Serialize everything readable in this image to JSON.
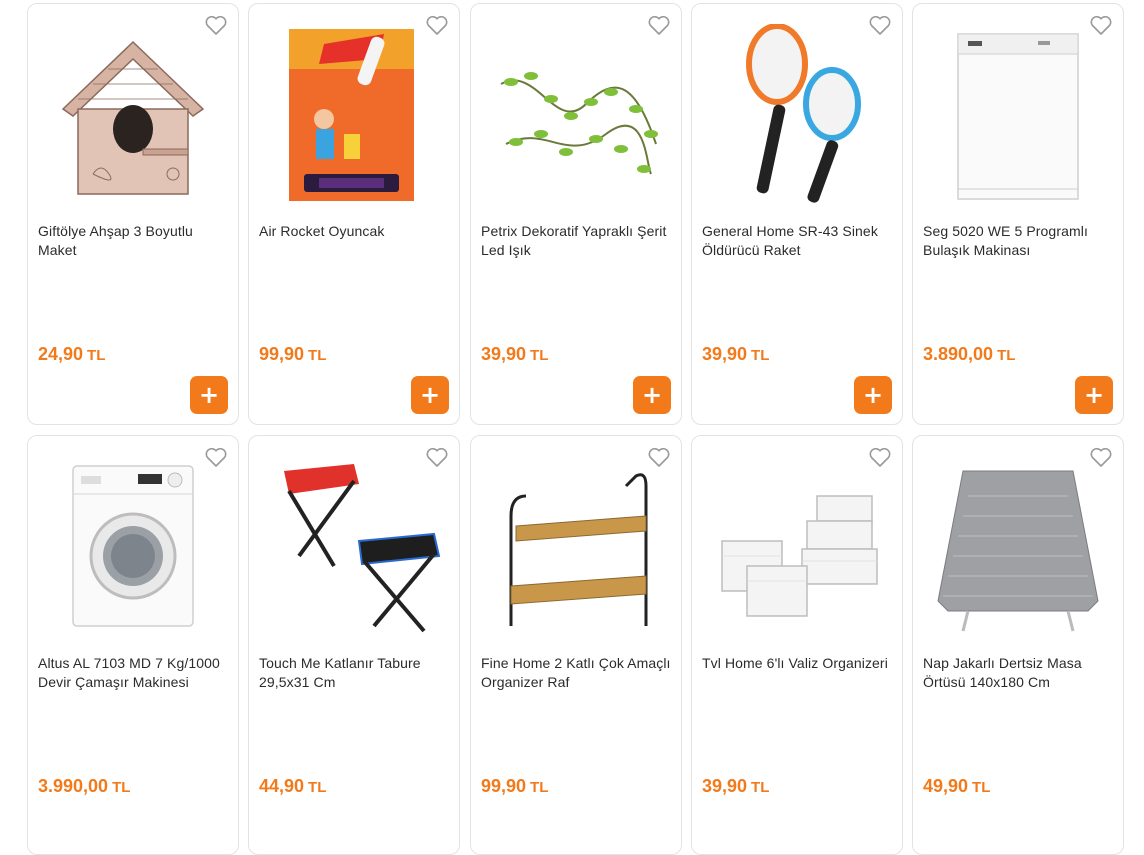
{
  "colors": {
    "accent": "#f27a1a",
    "border": "#e3e3e3",
    "text": "#2b2b2b"
  },
  "icons": {
    "favorite": "heart-outline-icon",
    "add": "plus-icon"
  },
  "add_label": "+",
  "products": [
    {
      "title": "Giftölye Ahşap 3 Boyutlu Maket",
      "price": "24,90",
      "currency": "TL",
      "image": "wooden-birdhouse"
    },
    {
      "title": "Air Rocket Oyuncak",
      "price": "99,90",
      "currency": "TL",
      "image": "air-rocket-box"
    },
    {
      "title": "Petrix Dekoratif Yapraklı Şerit Led Işık",
      "price": "39,90",
      "currency": "TL",
      "image": "leaf-garland"
    },
    {
      "title": "General Home SR-43 Sinek Öldürücü Raket",
      "price": "39,90",
      "currency": "TL",
      "image": "fly-swatter-rackets"
    },
    {
      "title": "Seg 5020 WE 5 Programlı Bulaşık Makinası",
      "price": "3.890,00",
      "currency": "TL",
      "image": "dishwasher"
    },
    {
      "title": "Altus AL 7103 MD 7 Kg/1000 Devir Çamaşır Makinesi",
      "price": "3.990,00",
      "currency": "TL",
      "image": "washing-machine"
    },
    {
      "title": "Touch Me Katlanır Tabure 29,5x31 Cm",
      "price": "44,90",
      "currency": "TL",
      "image": "folding-stools"
    },
    {
      "title": "Fine Home 2 Katlı Çok Amaçlı Organizer Raf",
      "price": "99,90",
      "currency": "TL",
      "image": "two-tier-shelf"
    },
    {
      "title": "Tvl Home 6'lı Valiz Organizeri",
      "price": "39,90",
      "currency": "TL",
      "image": "packing-cubes"
    },
    {
      "title": "Nap Jakarlı Dertsiz Masa Örtüsü 140x180 Cm",
      "price": "49,90",
      "currency": "TL",
      "image": "tablecloth"
    }
  ]
}
